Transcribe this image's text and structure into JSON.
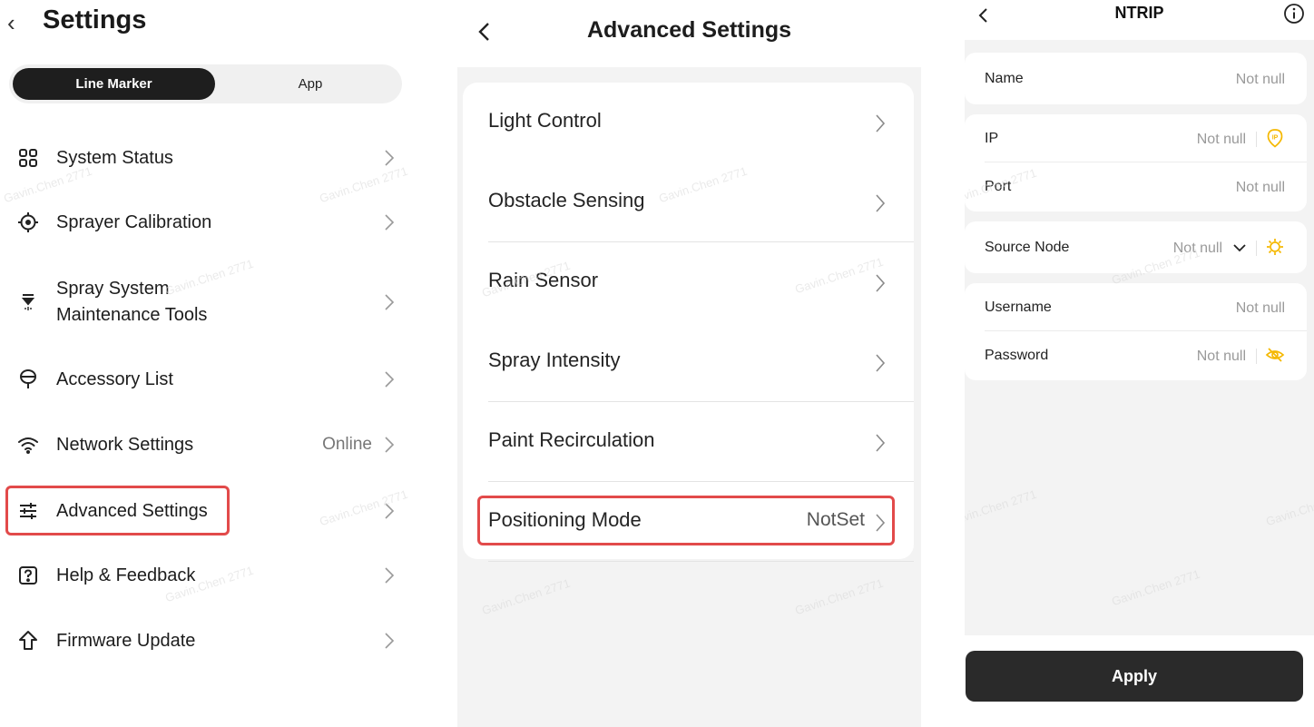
{
  "settings": {
    "title": "Settings",
    "tabs": {
      "active": "Line Marker",
      "inactive": "App"
    },
    "items": [
      {
        "label": "System Status",
        "value": "",
        "icon": "grid-icon"
      },
      {
        "label": "Sprayer Calibration",
        "value": "",
        "icon": "crosshair-icon"
      },
      {
        "label": "Spray System\nMaintenance Tools",
        "value": "",
        "icon": "sprayer-icon"
      },
      {
        "label": "Accessory List",
        "value": "",
        "icon": "balloon-icon"
      },
      {
        "label": "Network Settings",
        "value": "Online",
        "icon": "wifi-icon"
      },
      {
        "label": "Advanced Settings",
        "value": "",
        "icon": "sliders-icon"
      },
      {
        "label": "Help & Feedback",
        "value": "",
        "icon": "question-icon"
      },
      {
        "label": "Firmware Update",
        "value": "",
        "icon": "upload-arrow-icon"
      }
    ]
  },
  "advanced": {
    "title": "Advanced Settings",
    "items": [
      {
        "label": "Light Control",
        "value": ""
      },
      {
        "label": "Obstacle Sensing",
        "value": ""
      },
      {
        "label": "Rain Sensor",
        "value": ""
      },
      {
        "label": "Spray Intensity",
        "value": ""
      },
      {
        "label": "Paint Recirculation",
        "value": ""
      },
      {
        "label": "Positioning Mode",
        "value": "NotSet"
      }
    ]
  },
  "ntrip": {
    "title": "NTRIP",
    "name": {
      "label": "Name",
      "value": "Not null"
    },
    "ip": {
      "label": "IP",
      "value": "Not null"
    },
    "port": {
      "label": "Port",
      "value": "Not null"
    },
    "source_node": {
      "label": "Source Node",
      "value": "Not null"
    },
    "username": {
      "label": "Username",
      "value": "Not null"
    },
    "password": {
      "label": "Password",
      "value": "Not null"
    },
    "apply_label": "Apply"
  },
  "watermark": "Gavin.Chen 2771",
  "colors": {
    "highlight": "#e24a4a",
    "accent_icon": "#f5b800",
    "dark_button": "#2a2a2a"
  }
}
